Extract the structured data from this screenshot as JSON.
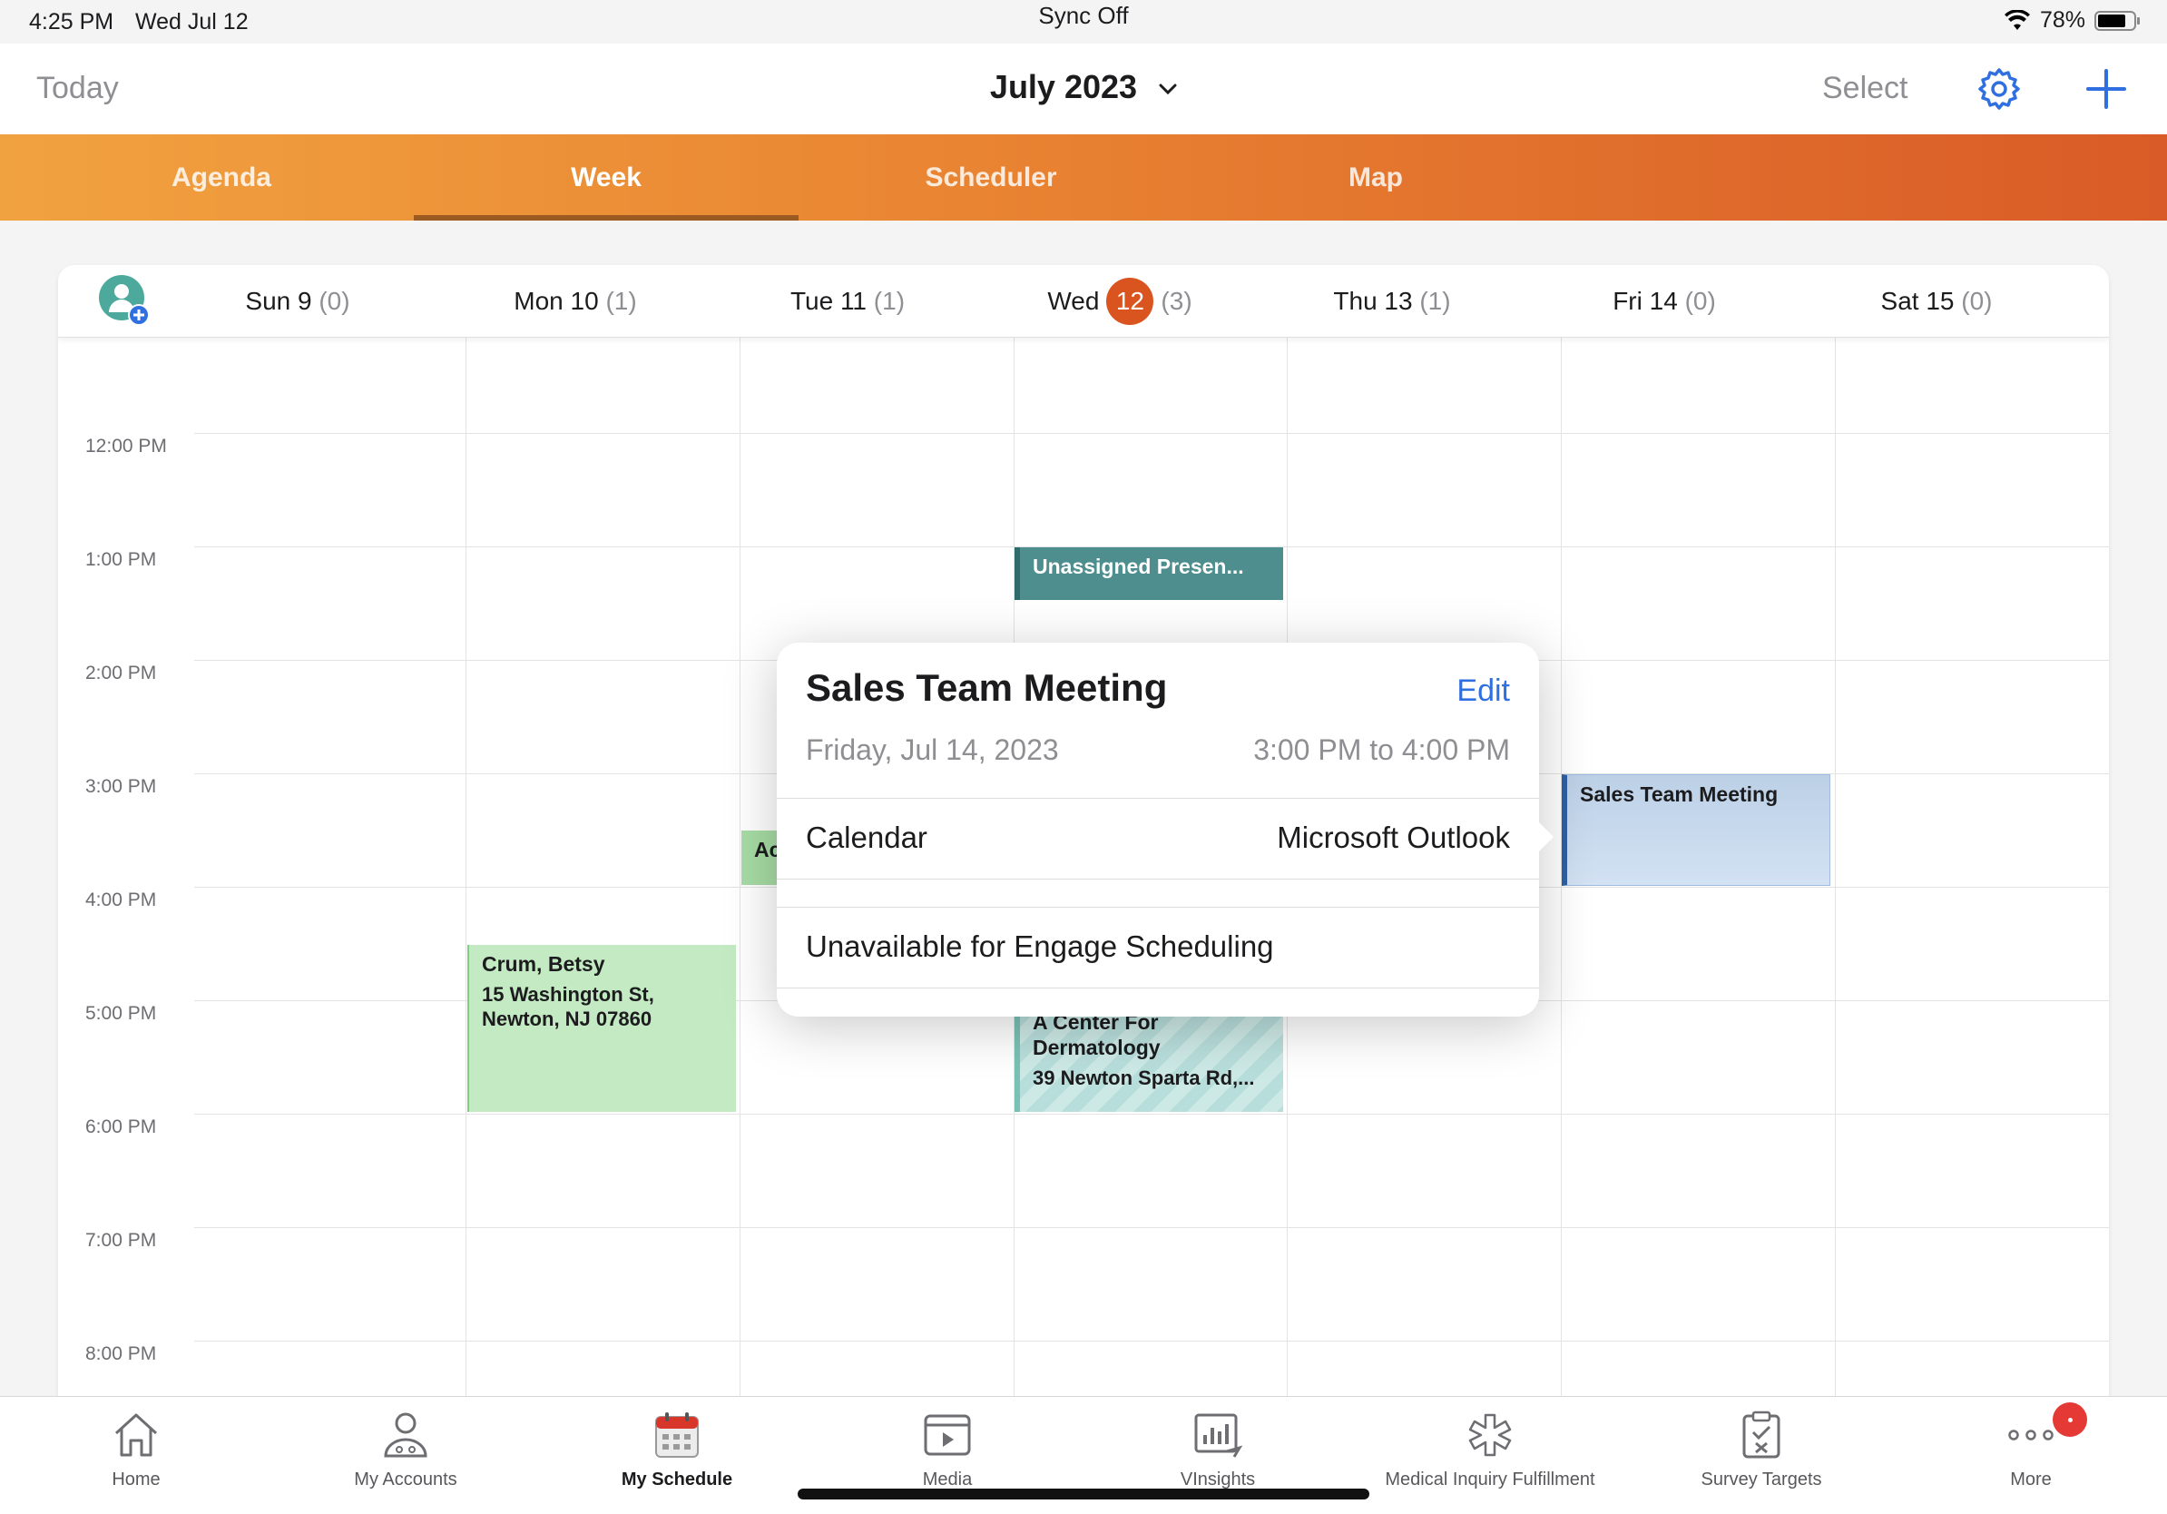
{
  "status": {
    "time": "4:25 PM",
    "date": "Wed Jul 12",
    "sync": "Sync Off",
    "battery": "78%"
  },
  "nav": {
    "today": "Today",
    "month": "July 2023",
    "select": "Select"
  },
  "tabs": [
    "Agenda",
    "Week",
    "Scheduler",
    "Map"
  ],
  "days": [
    {
      "label": "Sun 9",
      "count": "(0)"
    },
    {
      "label": "Mon 10",
      "count": "(1)"
    },
    {
      "label": "Tue 11",
      "count": "(1)"
    },
    {
      "prefix": "Wed",
      "num": "12",
      "count": "(3)"
    },
    {
      "label": "Thu 13",
      "count": "(1)"
    },
    {
      "label": "Fri 14",
      "count": "(0)"
    },
    {
      "label": "Sat 15",
      "count": "(0)"
    }
  ],
  "hours": [
    "12:00 PM",
    "1:00 PM",
    "2:00 PM",
    "3:00 PM",
    "4:00 PM",
    "5:00 PM",
    "6:00 PM",
    "7:00 PM",
    "8:00 PM"
  ],
  "events": {
    "unassigned": "Unassigned Presen...",
    "crum_title": "Crum, Betsy",
    "crum_addr": "15 Washington St, Newton, NJ 07860",
    "tue_partial": "Ac",
    "derm_title": "A Center For Dermatology",
    "derm_addr": "39 Newton Sparta Rd,...",
    "sales": "Sales Team Meeting"
  },
  "popover": {
    "title": "Sales Team Meeting",
    "edit": "Edit",
    "date": "Friday, Jul 14, 2023",
    "time": "3:00 PM to 4:00 PM",
    "calendar_label": "Calendar",
    "calendar_value": "Microsoft Outlook",
    "unavailable": "Unavailable for Engage Scheduling"
  },
  "bottom": [
    "Home",
    "My Accounts",
    "My Schedule",
    "Media",
    "VInsights",
    "Medical Inquiry Fulfillment",
    "Survey Targets",
    "More"
  ],
  "colors": {
    "accent": "#d9541e",
    "link": "#2f6fe0"
  }
}
